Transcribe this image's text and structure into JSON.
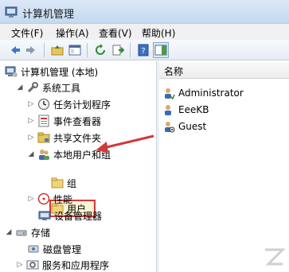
{
  "window": {
    "title": "计算机管理"
  },
  "menu": [
    "文件(F)",
    "操作(A)",
    "查看(V)",
    "帮助(H)"
  ],
  "tree": {
    "root": "计算机管理 (本地)",
    "system_tools": "系统工具",
    "task_scheduler": "任务计划程序",
    "event_viewer": "事件查看器",
    "shared_folders": "共享文件夹",
    "local_users_groups": "本地用户和组",
    "users": "用户",
    "groups": "组",
    "performance": "性能",
    "device_manager": "设备管理器",
    "storage": "存储",
    "disk_management": "磁盘管理",
    "services_apps": "服务和应用程序"
  },
  "list": {
    "column_name": "名称",
    "items": [
      "Administrator",
      "EeeKB",
      "Guest"
    ]
  },
  "colors": {
    "accent_red": "#cf3a3a",
    "titlebar": "#c4d9f0"
  }
}
